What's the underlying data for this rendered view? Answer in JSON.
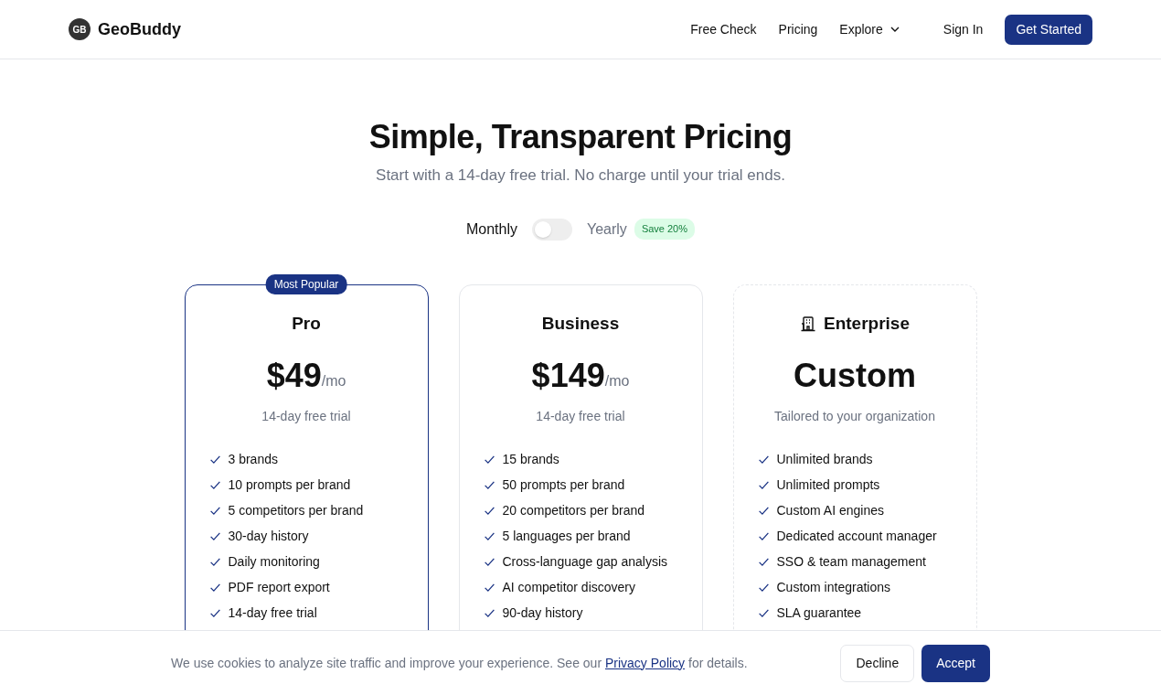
{
  "brand": {
    "logo": "GB",
    "name": "GeoBuddy"
  },
  "nav": [
    {
      "label": "Free Check",
      "kind": "link"
    },
    {
      "label": "Pricing",
      "kind": "link"
    },
    {
      "label": "Explore",
      "kind": "dropdown"
    },
    {
      "label": "Sign In",
      "kind": "link"
    },
    {
      "label": "Get Started",
      "kind": "button"
    }
  ],
  "hero": {
    "title": "Simple, Transparent Pricing",
    "subtitle": "Start with a 14-day free trial. No charge until your trial ends."
  },
  "billing": {
    "monthly": "Monthly",
    "yearly": "Yearly",
    "yearly_on": false,
    "save_badge": "Save 20%"
  },
  "plans": [
    {
      "name": "Pro",
      "badge": "Most Popular",
      "featured": true,
      "icon": false,
      "price": "$49",
      "period": "/mo",
      "note": "14-day free trial",
      "features": [
        "3 brands",
        "10 prompts per brand",
        "5 competitors per brand",
        "30-day history",
        "Daily monitoring",
        "PDF report export",
        "14-day free trial"
      ]
    },
    {
      "name": "Business",
      "featured": false,
      "icon": false,
      "price": "$149",
      "period": "/mo",
      "note": "14-day free trial",
      "features": [
        "15 brands",
        "50 prompts per brand",
        "20 competitors per brand",
        "5 languages per brand",
        "Cross-language gap analysis",
        "AI competitor discovery",
        "90-day history"
      ]
    },
    {
      "name": "Enterprise",
      "featured": false,
      "icon": true,
      "price": "Custom",
      "note": "Tailored to your organization",
      "features": [
        "Unlimited brands",
        "Unlimited prompts",
        "Custom AI engines",
        "Dedicated account manager",
        "SSO & team management",
        "Custom integrations",
        "SLA guarantee"
      ]
    }
  ],
  "cookie": {
    "text_before": "We use cookies to analyze site traffic and improve your experience. See our",
    "link": "Privacy Policy",
    "text_after": "for details.",
    "decline": "Decline",
    "accept": "Accept"
  }
}
